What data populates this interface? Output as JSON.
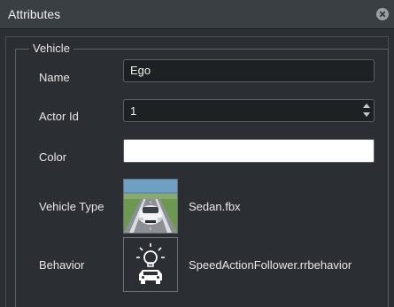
{
  "panel": {
    "title": "Attributes"
  },
  "group": {
    "title": "Vehicle"
  },
  "fields": {
    "name_label": "Name",
    "name_value": "Ego",
    "actor_id_label": "Actor Id",
    "actor_id_value": "1",
    "color_label": "Color",
    "color_value": "#ffffff",
    "vehicle_type_label": "Vehicle Type",
    "vehicle_type_value": "Sedan.fbx",
    "behavior_label": "Behavior",
    "behavior_value": "SpeedActionFollower.rrbehavior"
  },
  "icons": {
    "close": "close-circle-icon",
    "vehicle_thumbnail": "sedan-road-thumbnail",
    "behavior": "car-lightbulb-icon"
  },
  "colors": {
    "panel_bg": "#2b2f33",
    "header_bg": "#3a3f44",
    "field_bg": "#1e2124",
    "text": "#e8e8e8"
  }
}
